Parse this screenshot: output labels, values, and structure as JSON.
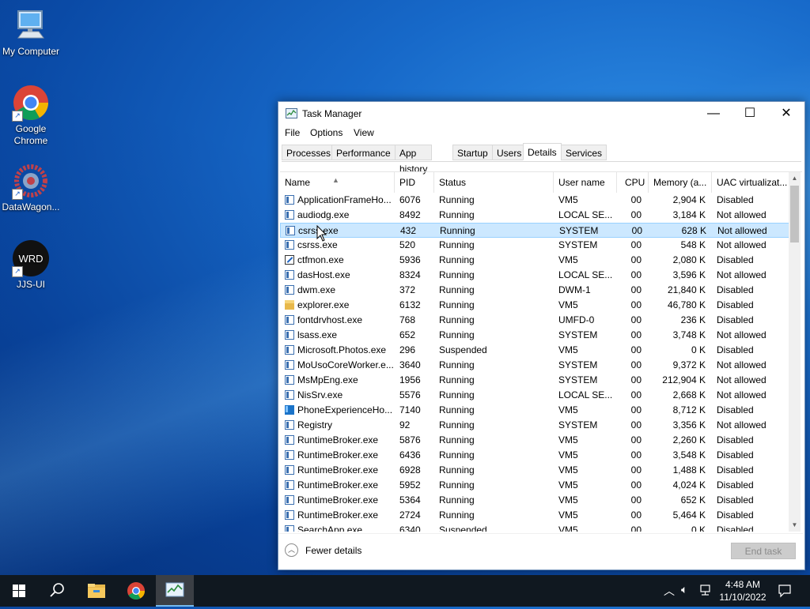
{
  "desktop": {
    "icons": [
      {
        "label": "My Computer"
      },
      {
        "label": "Google Chrome"
      },
      {
        "label": "DataWagon..."
      },
      {
        "label": "JJS-UI"
      }
    ],
    "jjs_logo_text": "WRD"
  },
  "window": {
    "title": "Task Manager",
    "controls": {
      "minimize": "—",
      "maximize": "☐",
      "close": "✕"
    },
    "menu": [
      "File",
      "Options",
      "View"
    ],
    "tabs": [
      "Processes",
      "Performance",
      "App history",
      "Startup",
      "Users",
      "Details",
      "Services"
    ],
    "active_tab": "Details",
    "columns": [
      "Name",
      "PID",
      "Status",
      "User name",
      "CPU",
      "Memory (a...",
      "UAC virtualizat..."
    ],
    "selected_row": 2,
    "rows": [
      {
        "name": "ApplicationFrameHo...",
        "pid": "6076",
        "status": "Running",
        "user": "VM5",
        "cpu": "00",
        "mem": "2,904 K",
        "uac": "Disabled",
        "icon": "app"
      },
      {
        "name": "audiodg.exe",
        "pid": "8492",
        "status": "Running",
        "user": "LOCAL SE...",
        "cpu": "00",
        "mem": "3,184 K",
        "uac": "Not allowed",
        "icon": "app"
      },
      {
        "name": "csrss.exe",
        "pid": "432",
        "status": "Running",
        "user": "SYSTEM",
        "cpu": "00",
        "mem": "628 K",
        "uac": "Not allowed",
        "icon": "app"
      },
      {
        "name": "csrss.exe",
        "pid": "520",
        "status": "Running",
        "user": "SYSTEM",
        "cpu": "00",
        "mem": "548 K",
        "uac": "Not allowed",
        "icon": "app"
      },
      {
        "name": "ctfmon.exe",
        "pid": "5936",
        "status": "Running",
        "user": "VM5",
        "cpu": "00",
        "mem": "2,080 K",
        "uac": "Disabled",
        "icon": "ctf"
      },
      {
        "name": "dasHost.exe",
        "pid": "8324",
        "status": "Running",
        "user": "LOCAL SE...",
        "cpu": "00",
        "mem": "3,596 K",
        "uac": "Not allowed",
        "icon": "app"
      },
      {
        "name": "dwm.exe",
        "pid": "372",
        "status": "Running",
        "user": "DWM-1",
        "cpu": "00",
        "mem": "21,840 K",
        "uac": "Disabled",
        "icon": "app"
      },
      {
        "name": "explorer.exe",
        "pid": "6132",
        "status": "Running",
        "user": "VM5",
        "cpu": "00",
        "mem": "46,780 K",
        "uac": "Disabled",
        "icon": "explorer"
      },
      {
        "name": "fontdrvhost.exe",
        "pid": "768",
        "status": "Running",
        "user": "UMFD-0",
        "cpu": "00",
        "mem": "236 K",
        "uac": "Disabled",
        "icon": "app"
      },
      {
        "name": "lsass.exe",
        "pid": "652",
        "status": "Running",
        "user": "SYSTEM",
        "cpu": "00",
        "mem": "3,748 K",
        "uac": "Not allowed",
        "icon": "app"
      },
      {
        "name": "Microsoft.Photos.exe",
        "pid": "296",
        "status": "Suspended",
        "user": "VM5",
        "cpu": "00",
        "mem": "0 K",
        "uac": "Disabled",
        "icon": "app"
      },
      {
        "name": "MoUsoCoreWorker.e...",
        "pid": "3640",
        "status": "Running",
        "user": "SYSTEM",
        "cpu": "00",
        "mem": "9,372 K",
        "uac": "Not allowed",
        "icon": "app"
      },
      {
        "name": "MsMpEng.exe",
        "pid": "1956",
        "status": "Running",
        "user": "SYSTEM",
        "cpu": "00",
        "mem": "212,904 K",
        "uac": "Not allowed",
        "icon": "app"
      },
      {
        "name": "NisSrv.exe",
        "pid": "5576",
        "status": "Running",
        "user": "LOCAL SE...",
        "cpu": "00",
        "mem": "2,668 K",
        "uac": "Not allowed",
        "icon": "app"
      },
      {
        "name": "PhoneExperienceHo...",
        "pid": "7140",
        "status": "Running",
        "user": "VM5",
        "cpu": "00",
        "mem": "8,712 K",
        "uac": "Disabled",
        "icon": "phone"
      },
      {
        "name": "Registry",
        "pid": "92",
        "status": "Running",
        "user": "SYSTEM",
        "cpu": "00",
        "mem": "3,356 K",
        "uac": "Not allowed",
        "icon": "app"
      },
      {
        "name": "RuntimeBroker.exe",
        "pid": "5876",
        "status": "Running",
        "user": "VM5",
        "cpu": "00",
        "mem": "2,260 K",
        "uac": "Disabled",
        "icon": "app"
      },
      {
        "name": "RuntimeBroker.exe",
        "pid": "6436",
        "status": "Running",
        "user": "VM5",
        "cpu": "00",
        "mem": "3,548 K",
        "uac": "Disabled",
        "icon": "app"
      },
      {
        "name": "RuntimeBroker.exe",
        "pid": "6928",
        "status": "Running",
        "user": "VM5",
        "cpu": "00",
        "mem": "1,488 K",
        "uac": "Disabled",
        "icon": "app"
      },
      {
        "name": "RuntimeBroker.exe",
        "pid": "5952",
        "status": "Running",
        "user": "VM5",
        "cpu": "00",
        "mem": "4,024 K",
        "uac": "Disabled",
        "icon": "app"
      },
      {
        "name": "RuntimeBroker.exe",
        "pid": "5364",
        "status": "Running",
        "user": "VM5",
        "cpu": "00",
        "mem": "652 K",
        "uac": "Disabled",
        "icon": "app"
      },
      {
        "name": "RuntimeBroker.exe",
        "pid": "2724",
        "status": "Running",
        "user": "VM5",
        "cpu": "00",
        "mem": "5,464 K",
        "uac": "Disabled",
        "icon": "app"
      },
      {
        "name": "SearchApp.exe",
        "pid": "6340",
        "status": "Suspended",
        "user": "VM5",
        "cpu": "00",
        "mem": "0 K",
        "uac": "Disabled",
        "icon": "app"
      }
    ],
    "footer": {
      "fewer_details": "Fewer details",
      "end_task": "End task"
    }
  },
  "taskbar": {
    "clock_time": "4:48 AM",
    "clock_date": "11/10/2022",
    "colors": {
      "background": "#101820",
      "accent": "#76b9ed"
    }
  }
}
